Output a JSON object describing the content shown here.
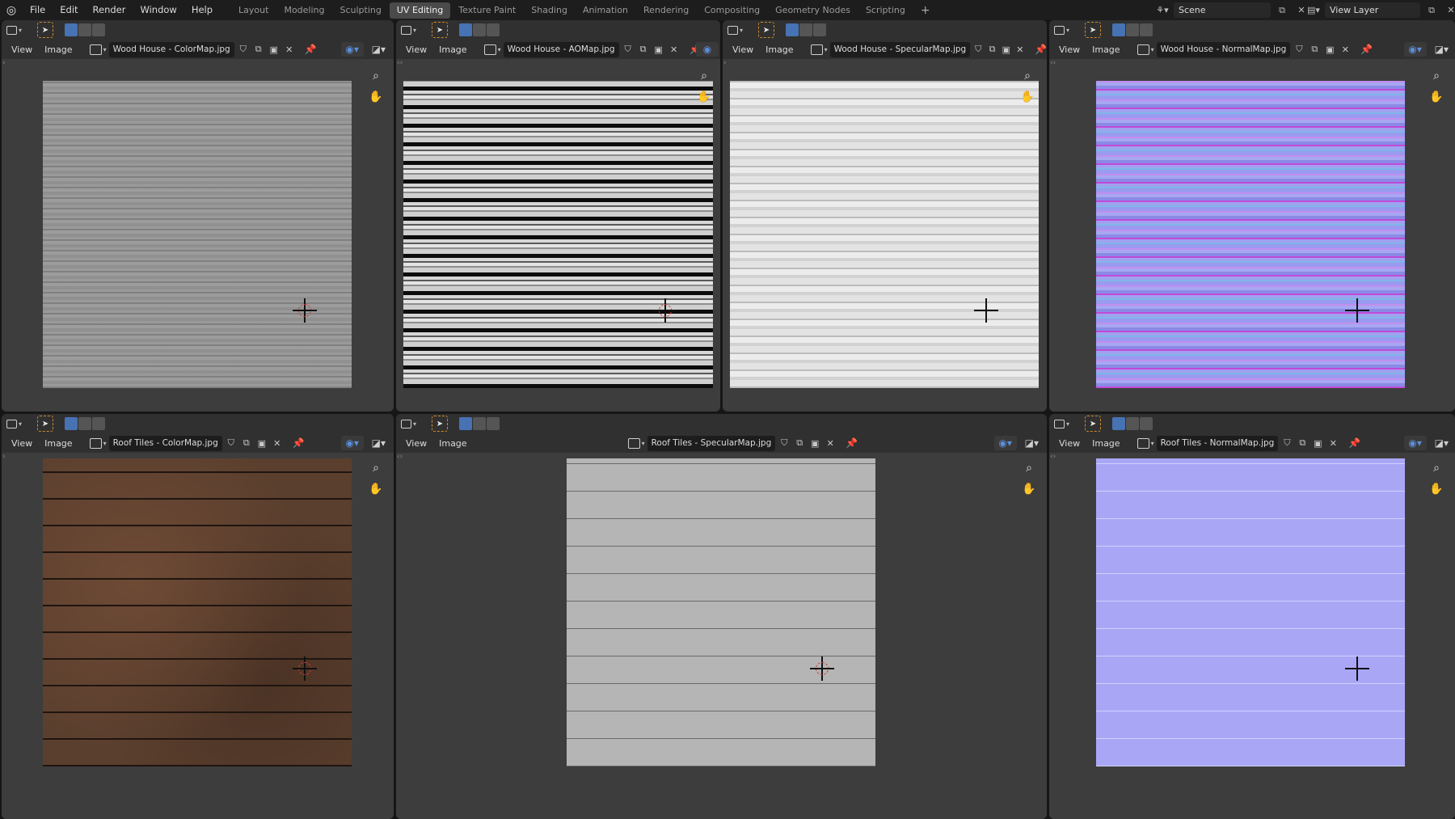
{
  "menus": [
    "File",
    "Edit",
    "Render",
    "Window",
    "Help"
  ],
  "workspaces": [
    "Layout",
    "Modeling",
    "Sculpting",
    "UV Editing",
    "Texture Paint",
    "Shading",
    "Animation",
    "Rendering",
    "Compositing",
    "Geometry Nodes",
    "Scripting"
  ],
  "active_workspace": "UV Editing",
  "scene": {
    "label": "Scene"
  },
  "view_layer": {
    "label": "View Layer"
  },
  "editor_menu": {
    "view": "View",
    "image": "Image"
  },
  "editors": [
    {
      "image": "Wood House - ColorMap.jpg"
    },
    {
      "image": "Wood House - AOMap.jpg"
    },
    {
      "image": "Wood House - SpecularMap.jpg"
    },
    {
      "image": "Wood House - NormalMap.jpg"
    },
    {
      "image": "Roof Tiles - ColorMap.jpg"
    },
    {
      "image": "Roof Tiles - SpecularMap.jpg"
    },
    {
      "image": "Roof Tiles - NormalMap.jpg"
    }
  ],
  "colors": {
    "accent": "#4772b3",
    "active_tab": "#4a4a4a",
    "select_outline": "#d18a2a"
  }
}
